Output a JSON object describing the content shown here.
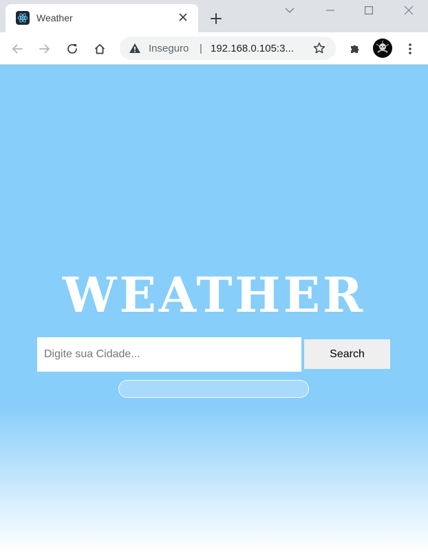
{
  "browser": {
    "tab": {
      "title": "Weather",
      "favicon": "react-logo-icon"
    },
    "address_bar": {
      "security_label": "Inseguro",
      "separator": "|",
      "url": "192.168.0.105:3..."
    },
    "icons": {
      "back": "back-arrow-icon",
      "forward": "forward-arrow-icon",
      "reload": "reload-icon",
      "home": "home-icon",
      "bookmark": "star-icon",
      "extensions": "puzzle-icon",
      "menu": "kebab-menu-icon"
    }
  },
  "page": {
    "title": "WEATHER",
    "search": {
      "placeholder": "Digite sua Cidade...",
      "value": "",
      "button_label": "Search"
    },
    "result_text": ""
  },
  "colors": {
    "background": "#87cefa",
    "tab_strip": "#dee1e6",
    "button": "#efefef"
  }
}
